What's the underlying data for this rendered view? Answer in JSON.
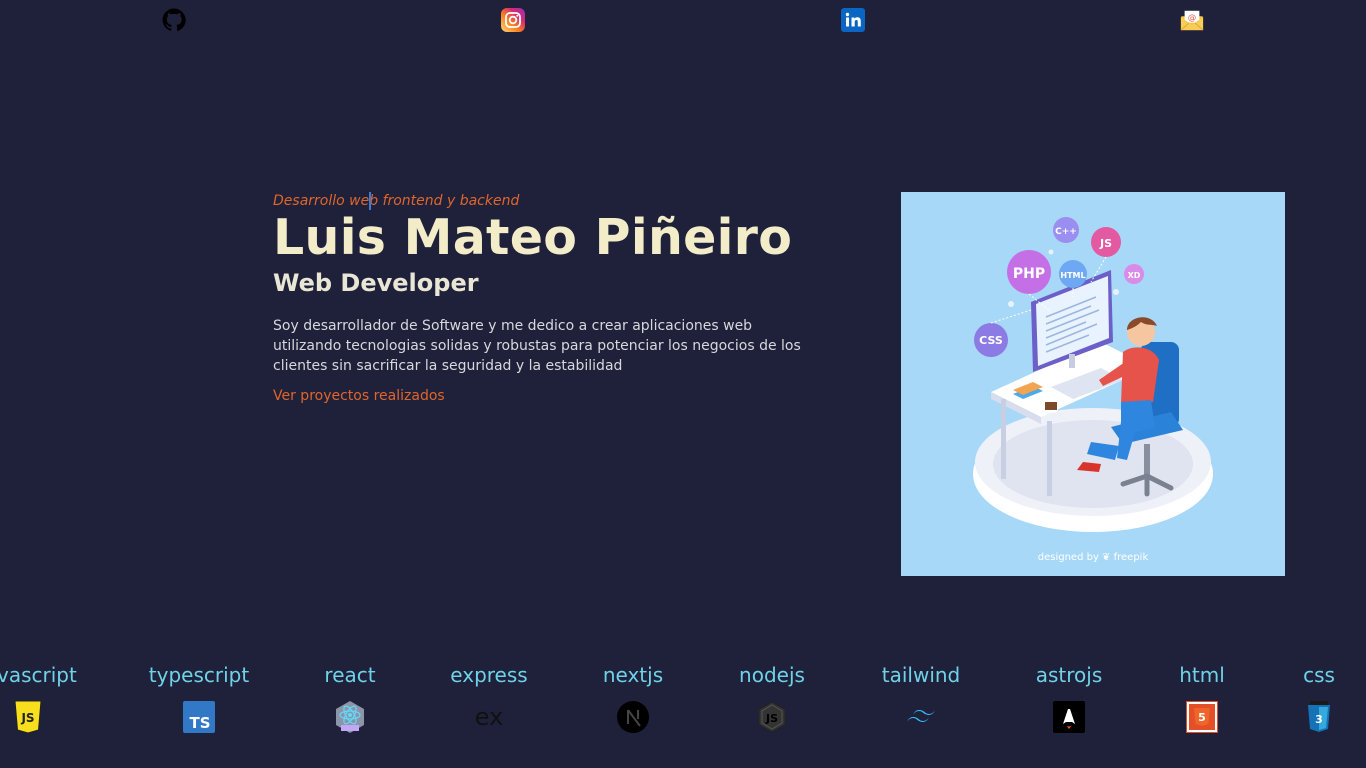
{
  "social": [
    {
      "name": "github-icon",
      "color": "#000000"
    },
    {
      "name": "instagram-icon",
      "color": "#e1306c"
    },
    {
      "name": "linkedin-icon",
      "color": "#0a66c2"
    },
    {
      "name": "email-icon",
      "color": "#f5c242"
    }
  ],
  "hero": {
    "eyebrow": "Desarrollo web frontend y backend",
    "name": "Luis Mateo Piñeiro",
    "role": "Web Developer",
    "description": "Soy desarrollador de Software y me dedico a crear aplicaciones web utilizando tecnologias solidas y robustas para potenciar los negocios de los clientes sin sacrificar la seguridad y la estabilidad",
    "cta": "Ver proyectos realizados"
  },
  "illustration": {
    "credit": "designed by ❦ freepik",
    "bubbles": [
      "PHP",
      "CSS",
      "HTML",
      "C++",
      "JS",
      "XD"
    ]
  },
  "tech": [
    {
      "label": "javascript",
      "icon": "javascript-icon",
      "color": "#f7df1e"
    },
    {
      "label": "typescript",
      "icon": "typescript-icon",
      "color": "#3178c6"
    },
    {
      "label": "react",
      "icon": "react-icon",
      "color": "#61dafb"
    },
    {
      "label": "express",
      "icon": "express-icon",
      "color": "#000000"
    },
    {
      "label": "nextjs",
      "icon": "nextjs-icon",
      "color": "#000000"
    },
    {
      "label": "nodejs",
      "icon": "nodejs-icon",
      "color": "#333333"
    },
    {
      "label": "tailwind",
      "icon": "tailwind-icon",
      "color": "#38bdf8"
    },
    {
      "label": "astrojs",
      "icon": "astrojs-icon",
      "color": "#ff5d01"
    },
    {
      "label": "html",
      "icon": "html-icon",
      "color": "#e34f26"
    },
    {
      "label": "css",
      "icon": "css-icon",
      "color": "#1572b6"
    }
  ]
}
